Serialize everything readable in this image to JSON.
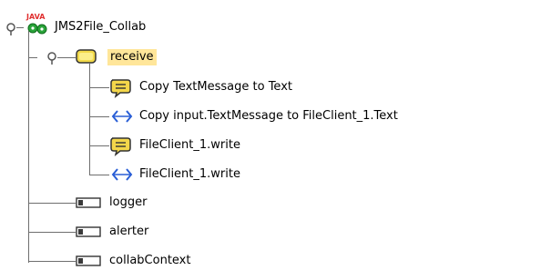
{
  "tree": {
    "root": {
      "label": "JMS2File_Collab",
      "badge": "JAVA",
      "icon": "java-collaboration-icon",
      "expanded": true,
      "children": [
        {
          "label": "receive",
          "icon": "folder-icon",
          "selected": true,
          "expanded": true,
          "children": [
            {
              "label": "Copy TextMessage to Text",
              "icon": "comment-bubble-icon"
            },
            {
              "label": "Copy input.TextMessage to FileClient_1.Text",
              "icon": "map-arrows-icon"
            },
            {
              "label": "FileClient_1.write",
              "icon": "comment-bubble-icon"
            },
            {
              "label": "FileClient_1.write",
              "icon": "map-arrows-icon"
            }
          ]
        },
        {
          "label": "logger",
          "icon": "variable-icon"
        },
        {
          "label": "alerter",
          "icon": "variable-icon"
        },
        {
          "label": "collabContext",
          "icon": "variable-icon"
        }
      ]
    }
  },
  "colors": {
    "selection": "#ffe69a",
    "folder": "#f2d94a",
    "comment": "#f3d64a",
    "arrows": "#2a5fd6",
    "badge": "#e03030",
    "gear": "#2aa43a",
    "lines": "#6e6e6e"
  }
}
